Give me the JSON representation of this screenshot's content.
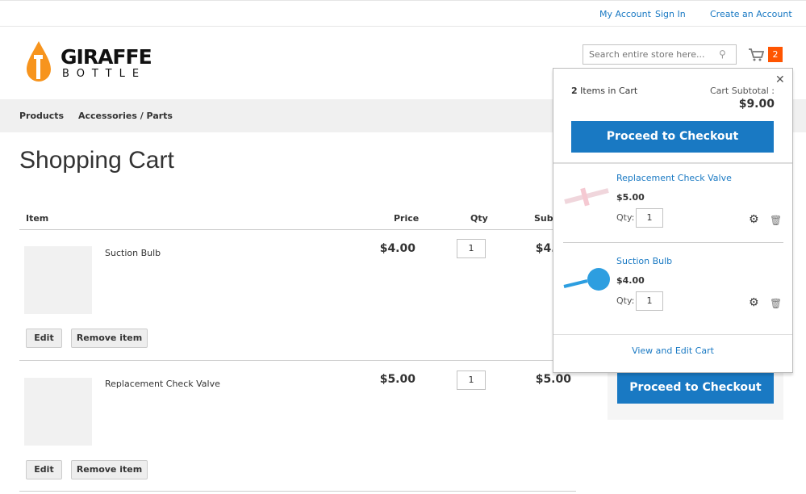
{
  "top_links": {
    "my_account": "My Account",
    "sign_in": "Sign In",
    "create_account": "Create an Account"
  },
  "logo": {
    "line1": "GIRAFFE",
    "line2": "BOTTLE",
    "color": "#f7941d"
  },
  "search": {
    "placeholder": "Search entire store here..."
  },
  "cart_badge": "2",
  "nav": [
    "Products",
    "Accessories / Parts"
  ],
  "page_title": "Shopping Cart",
  "table": {
    "headers": [
      "Item",
      "Price",
      "Qty",
      "Subtotal"
    ],
    "rows": [
      {
        "name": "Suction Bulb",
        "price": "$4.00",
        "qty": "1",
        "subtotal": "$4.00",
        "edit": "Edit",
        "remove": "Remove item"
      },
      {
        "name": "Replacement Check Valve",
        "price": "$5.00",
        "qty": "1",
        "subtotal": "$5.00",
        "edit": "Edit",
        "remove": "Remove item"
      }
    ]
  },
  "summary": {
    "checkout": "Proceed to Checkout"
  },
  "minicart": {
    "count": "2",
    "items_label": "Items in Cart",
    "subtotal_label": "Cart Subtotal :",
    "subtotal": "$9.00",
    "checkout": "Proceed to Checkout",
    "qty_label": "Qty:",
    "items": [
      {
        "name": "Replacement Check Valve",
        "price": "$5.00",
        "qty": "1"
      },
      {
        "name": "Suction Bulb",
        "price": "$4.00",
        "qty": "1"
      }
    ],
    "view_edit": "View and Edit Cart"
  },
  "colors": {
    "accent": "#1979c3",
    "badge": "#ff5501"
  }
}
